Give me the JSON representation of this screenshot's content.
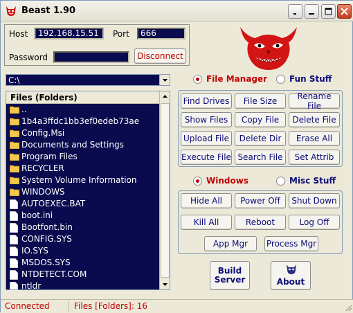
{
  "window": {
    "title": "Beast 1.90"
  },
  "connection": {
    "host_label": "Host",
    "host_value": "192.168.15.51",
    "port_label": "Port",
    "port_value": "666",
    "password_label": "Password",
    "password_value": "",
    "disconnect_label": "Disconnect"
  },
  "path": {
    "value": "C:\\"
  },
  "files": {
    "header": "Files (Folders)",
    "rows": [
      {
        "name": "..",
        "kind": "folder"
      },
      {
        "name": "1b4a3ffdc1bb3ef0edeb73ae",
        "kind": "folder"
      },
      {
        "name": "Config.Msi",
        "kind": "folder"
      },
      {
        "name": "Documents and Settings",
        "kind": "folder"
      },
      {
        "name": "Program Files",
        "kind": "folder"
      },
      {
        "name": "RECYCLER",
        "kind": "folder"
      },
      {
        "name": "System Volume Information",
        "kind": "folder"
      },
      {
        "name": "WINDOWS",
        "kind": "folder"
      },
      {
        "name": "AUTOEXEC.BAT",
        "kind": "file"
      },
      {
        "name": "boot.ini",
        "kind": "file"
      },
      {
        "name": "Bootfont.bin",
        "kind": "file"
      },
      {
        "name": "CONFIG.SYS",
        "kind": "file"
      },
      {
        "name": "IO.SYS",
        "kind": "file"
      },
      {
        "name": "MSDOS.SYS",
        "kind": "file"
      },
      {
        "name": "NTDETECT.COM",
        "kind": "file"
      },
      {
        "name": "ntldr",
        "kind": "file"
      }
    ]
  },
  "modes": {
    "file_manager": "File Manager",
    "fun_stuff": "Fun Stuff",
    "selected": "File Manager"
  },
  "file_buttons": [
    "Find Drives",
    "File Size",
    "Rename File",
    "Show Files",
    "Copy File",
    "Delete File",
    "Upload File",
    "Delete Dir",
    "Erase All",
    "Execute File",
    "Search File",
    "Set Attrib"
  ],
  "modes2": {
    "windows": "Windows",
    "misc_stuff": "Misc Stuff",
    "selected": "Windows"
  },
  "window_buttons": [
    "Hide All",
    "Power Off",
    "Shut Down",
    "Kill All",
    "Reboot",
    "Log Off"
  ],
  "manager_buttons": [
    "App Mgr",
    "Process Mgr"
  ],
  "bottom_buttons": {
    "build": "Build\nServer",
    "about": "About"
  },
  "status": {
    "connection": "Connected",
    "files_count": "Files [Folders]: 16"
  },
  "icons": {
    "app": "devil-icon",
    "logo": "devil-logo",
    "folder": "folder-icon",
    "file": "file-icon",
    "about": "devil-icon"
  },
  "colors": {
    "accent_red": "#C00000",
    "navy": "#0A0A4E",
    "button_text": "#0C0C7A"
  }
}
